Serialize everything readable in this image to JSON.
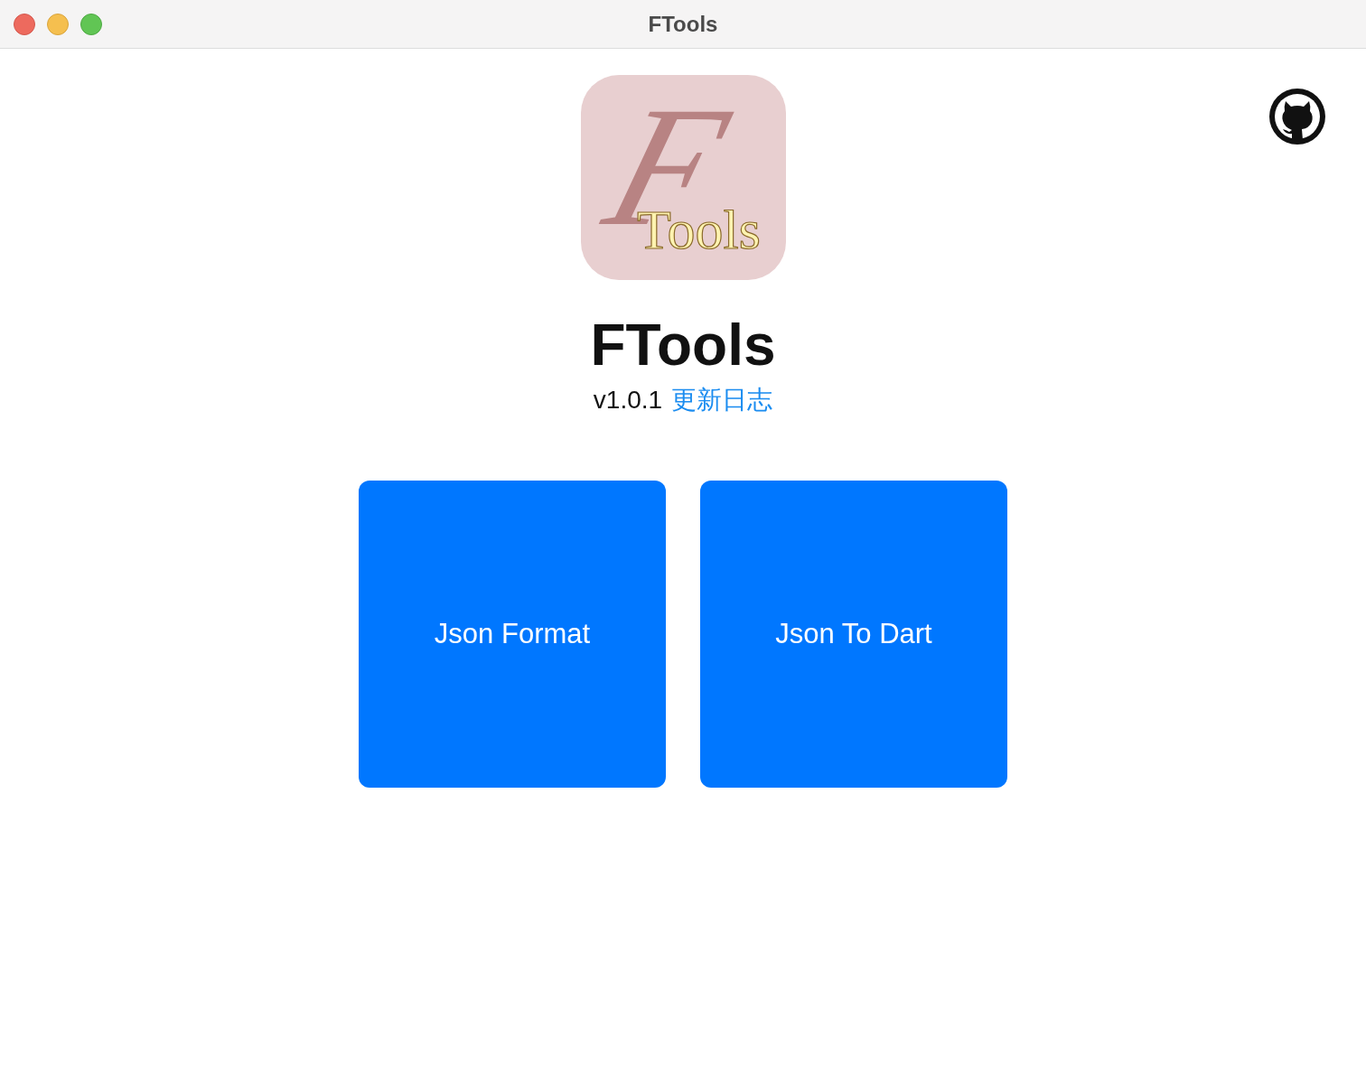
{
  "window": {
    "title": "FTools"
  },
  "logo": {
    "letter": "F",
    "word": "Tools"
  },
  "app_name": "FTools",
  "version": "v1.0.1",
  "changelog_link": "更新日志",
  "tools": [
    {
      "label": "Json Format"
    },
    {
      "label": "Json To Dart"
    }
  ]
}
